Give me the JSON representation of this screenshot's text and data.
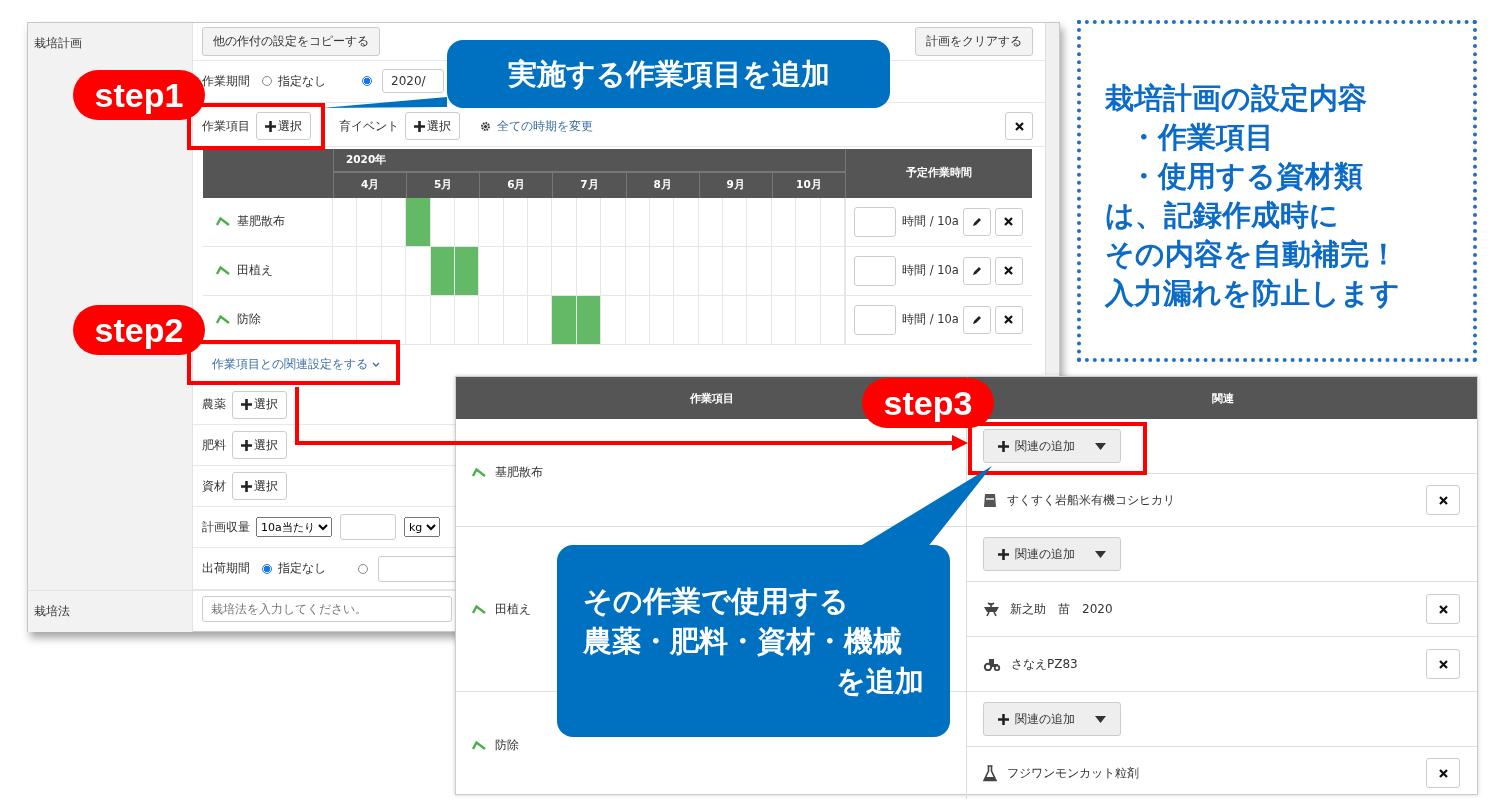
{
  "plan_window": {
    "section_label": "栽培計画",
    "copy_button": "他の作付の設定をコピーする",
    "clear_button": "計画をクリアする",
    "period": {
      "label": "作業期間",
      "none_option": {
        "label": "指定なし",
        "selected": false
      },
      "range_option": {
        "selected": true,
        "value": "2020/"
      }
    },
    "work_items": {
      "label": "作業項目",
      "button": "選択"
    },
    "growth_event": {
      "label": "育イベント",
      "button": "選択"
    },
    "change_all_link": "全ての時期を変更",
    "gantt": {
      "year": "2020年",
      "months": [
        "4月",
        "5月",
        "6月",
        "7月",
        "8月",
        "9月",
        "10月"
      ],
      "hours_header": "予定作業時間",
      "rows": [
        {
          "name": "基肥散布",
          "unit": "時間 / 10a",
          "scheduled": [
            false,
            false,
            false,
            true,
            false,
            false,
            false,
            false,
            false,
            false,
            false,
            false,
            false,
            false,
            false,
            false,
            false,
            false,
            false,
            false,
            false
          ]
        },
        {
          "name": "田植え",
          "unit": "時間 / 10a",
          "scheduled": [
            false,
            false,
            false,
            false,
            true,
            true,
            false,
            false,
            false,
            false,
            false,
            false,
            false,
            false,
            false,
            false,
            false,
            false,
            false,
            false,
            false
          ]
        },
        {
          "name": "防除",
          "unit": "時間 / 10a",
          "scheduled": [
            false,
            false,
            false,
            false,
            false,
            false,
            false,
            false,
            false,
            true,
            true,
            false,
            false,
            false,
            false,
            false,
            false,
            false,
            false,
            false,
            false
          ]
        }
      ]
    },
    "relation_link": "作業項目との関連設定をする",
    "materials": [
      {
        "label": "農薬",
        "button": "選択"
      },
      {
        "label": "肥料",
        "button": "選択"
      },
      {
        "label": "資材",
        "button": "選択"
      }
    ],
    "yield": {
      "label": "計画収量",
      "basis": "10a当たり",
      "unit": "kg"
    },
    "shipping": {
      "label": "出荷期間",
      "none_option": {
        "label": "指定なし",
        "selected": true
      },
      "range_option": {
        "selected": false
      }
    },
    "method": {
      "label": "栽培法",
      "placeholder": "栽培法を入力してください。"
    }
  },
  "relation_window": {
    "columns": [
      "作業項目",
      "関連"
    ],
    "groups": [
      {
        "name": "基肥散布",
        "add_button": "関連の追加",
        "items": [
          {
            "kind": "fertilizer",
            "name": "すくすく岩船米有機コシヒカリ"
          }
        ]
      },
      {
        "name": "田植え",
        "add_button": "関連の追加",
        "items": [
          {
            "kind": "seedling",
            "name": "新之助　苗　2020"
          },
          {
            "kind": "machine",
            "name": "さなえPZ83"
          }
        ]
      },
      {
        "name": "防除",
        "add_button": "関連の追加",
        "items": [
          {
            "kind": "pesticide",
            "name": "フジワンモンカット粒剤"
          }
        ]
      }
    ]
  },
  "steps": [
    "step1",
    "step2",
    "step3"
  ],
  "callouts": [
    {
      "lines": [
        "実施する作業項目を追加"
      ]
    },
    {
      "lines": [
        "その作業で使用する",
        "農薬・肥料・資材・機械",
        "を追加"
      ]
    }
  ],
  "note": {
    "lines": [
      {
        "kind": "heading",
        "text": "栽培計画の設定内容"
      },
      {
        "kind": "bullet",
        "text": "・作業項目"
      },
      {
        "kind": "bullet",
        "text": "・使用する資材類"
      },
      {
        "kind": "body",
        "text": "は、記録作成時に"
      },
      {
        "kind": "body",
        "text": "その内容を自動補完！"
      },
      {
        "kind": "body",
        "text": "入力漏れを防止します"
      }
    ]
  }
}
